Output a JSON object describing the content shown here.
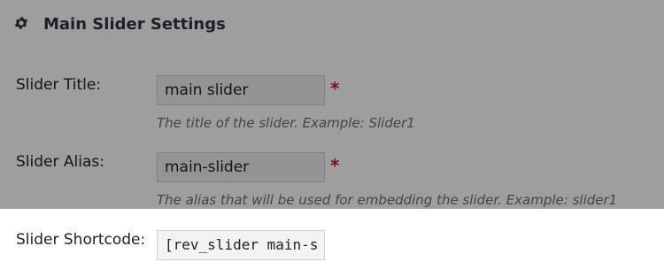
{
  "header": {
    "title": "Main Slider Settings",
    "icon": "gear-icon"
  },
  "fields": {
    "title": {
      "label": "Slider Title:",
      "value": "main slider",
      "required_mark": "*",
      "hint": "The title of the slider. Example: Slider1"
    },
    "alias": {
      "label": "Slider Alias:",
      "value": "main-slider",
      "required_mark": "*",
      "hint": "The alias that will be used for embedding the slider. Example: slider1"
    },
    "shortcode": {
      "label": "Slider Shortcode:",
      "value": "[rev_slider main-s"
    }
  },
  "colors": {
    "required": "#c0232b",
    "overlay": "rgba(0,0,0,0.38)"
  }
}
